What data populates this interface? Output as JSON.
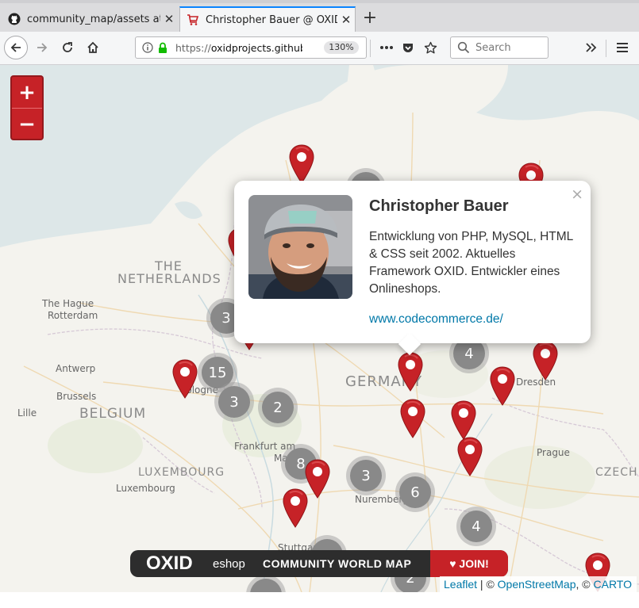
{
  "browser": {
    "tabs": [
      {
        "label": "community_map/assets at master",
        "icon": "github-icon",
        "active": false
      },
      {
        "label": "Christopher Bauer @ OXID Community World Map",
        "icon": "cart-icon",
        "active": true
      }
    ],
    "url_scheme": "https://",
    "url_host": "oxidprojects.github.i",
    "zoom": "130%",
    "search_placeholder": "Search"
  },
  "map": {
    "zoom_in": "+",
    "zoom_out": "−",
    "countries": [
      {
        "name": "THE",
        "key": "nl1"
      },
      {
        "name": "NETHERLANDS",
        "key": "nl2"
      },
      {
        "name": "BELGIUM",
        "key": "be"
      },
      {
        "name": "GERMANY",
        "key": "de"
      },
      {
        "name": "LUXEMBOURG",
        "key": "lu"
      },
      {
        "name": "CZECH",
        "key": "cz"
      }
    ],
    "cities": [
      {
        "name": "The Hague",
        "key": "hague"
      },
      {
        "name": "Rotterdam",
        "key": "rotterdam"
      },
      {
        "name": "Antwerp",
        "key": "antwerp"
      },
      {
        "name": "Brussels",
        "key": "brussels"
      },
      {
        "name": "Lille",
        "key": "lille"
      },
      {
        "name": "Cologne",
        "key": "cologne"
      },
      {
        "name": "Frankfurt am",
        "key": "frankfurt1"
      },
      {
        "name": "Main",
        "key": "frankfurt2"
      },
      {
        "name": "Luxembourg",
        "key": "luxcity"
      },
      {
        "name": "Dresden",
        "key": "dresden"
      },
      {
        "name": "Prague",
        "key": "prague"
      },
      {
        "name": "Nuremberg",
        "key": "nuremberg"
      },
      {
        "name": "Stuttgart",
        "key": "stuttgart"
      }
    ],
    "clusters": [
      "3",
      "15",
      "3",
      "2",
      "8",
      "3",
      "6",
      "4",
      "4",
      "2"
    ]
  },
  "popup": {
    "name": "Christopher Bauer",
    "description": "Entwicklung von PHP, MySQL, HTML & CSS seit 2002. Aktuelles Framework OXID. Entwickler eines Onlineshops.",
    "link": "www.codecommerce.de/",
    "close": "×"
  },
  "banner": {
    "logo": "OXID",
    "eshop": "eshop",
    "title": "COMMUNITY WORLD MAP",
    "join": "♥ JOIN!"
  },
  "attribution": {
    "leaflet": "Leaflet",
    "sep1": " | © ",
    "osm": "OpenStreetMap",
    "sep2": ", © ",
    "carto": "CARTO"
  },
  "colors": {
    "accent": "#c62227",
    "link": "#0078a8",
    "tab_highlight": "#0a84ff",
    "cluster": "#898989"
  }
}
